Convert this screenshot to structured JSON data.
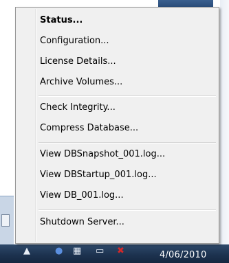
{
  "menu": {
    "items": [
      {
        "label": "Status...",
        "bold": true
      },
      {
        "label": "Configuration..."
      },
      {
        "label": "License Details..."
      },
      {
        "label": "Archive Volumes..."
      },
      {
        "label": "Check Integrity..."
      },
      {
        "label": "Compress Database..."
      },
      {
        "label": "View DBSnapshot_001.log..."
      },
      {
        "label": "View DBStartup_001.log..."
      },
      {
        "label": "View DB_001.log..."
      },
      {
        "label": "Shutdown Server..."
      }
    ]
  },
  "taskbar": {
    "date": "4/06/2010",
    "tray_icons": [
      "up-arrow-icon",
      "shield-icon",
      "network-icon",
      "monitor-icon",
      "red-x-icon"
    ]
  }
}
